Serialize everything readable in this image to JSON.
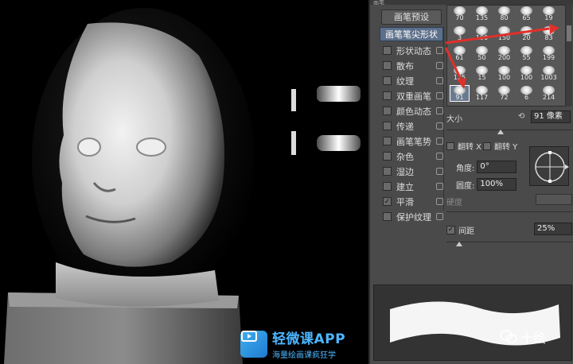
{
  "panel": {
    "header_label": "画笔",
    "presets_button": "画笔预设",
    "options": [
      {
        "label": "画笔笔尖形状",
        "checked": null,
        "active": true
      },
      {
        "label": "形状动态",
        "checked": false
      },
      {
        "label": "散布",
        "checked": false
      },
      {
        "label": "纹理",
        "checked": false
      },
      {
        "label": "双重画笔",
        "checked": false
      },
      {
        "label": "颜色动态",
        "checked": false
      },
      {
        "label": "传递",
        "checked": false
      },
      {
        "label": "画笔笔势",
        "checked": false
      },
      {
        "label": "杂色",
        "checked": false
      },
      {
        "label": "湿边",
        "checked": false
      },
      {
        "label": "建立",
        "checked": false
      },
      {
        "label": "平滑",
        "checked": true
      },
      {
        "label": "保护纹理",
        "checked": false
      }
    ],
    "tips": [
      [
        "70",
        "135",
        "80",
        "65",
        "19"
      ],
      [
        "3",
        "190",
        "150",
        "20",
        "83"
      ],
      [
        "61",
        "50",
        "200",
        "55",
        "199"
      ],
      [
        "125",
        "15",
        "100",
        "100",
        "1003"
      ],
      [
        "91",
        "117",
        "72",
        "6",
        "214"
      ]
    ],
    "selected_tip": "91",
    "size_label": "大小",
    "size_value": "91 像素",
    "flip_x_label": "翻转 X",
    "flip_y_label": "翻转 Y",
    "angle_label": "角度:",
    "angle_value": "0°",
    "roundness_label": "圆度:",
    "roundness_value": "100%",
    "hardness_label": "硬度",
    "spacing_label": "间距",
    "spacing_checked": true,
    "spacing_value": "25%"
  },
  "watermark": {
    "title": "轻微课APP",
    "subtitle": "海量绘画课疯狂学"
  },
  "wechat": {
    "account": "十绘"
  },
  "colors": {
    "panel_bg": "#4a4a4a",
    "highlight": "#5c6f8a",
    "arrow": "#e0302a",
    "watermark": "#4db6ff"
  }
}
